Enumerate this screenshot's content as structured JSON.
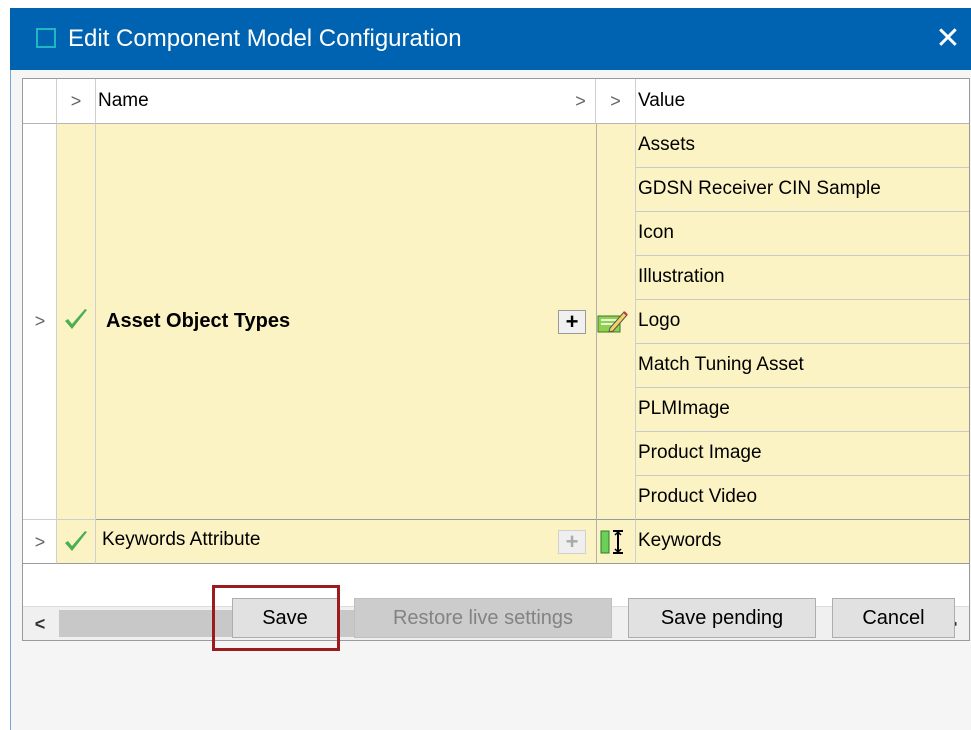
{
  "window": {
    "title": "Edit Component Model Configuration",
    "close_glyph": "✕"
  },
  "grid": {
    "header": {
      "expand_glyph": ">",
      "name": "Name",
      "name_chevron": ">",
      "value_chevron": ">",
      "value": "Value"
    },
    "rows": [
      {
        "expander": ">",
        "status_icon": "checkmark-icon",
        "name": "Asset Object Types",
        "bold": true,
        "add_glyph": "+",
        "add_enabled": true,
        "editor_icon": "edit-list-icon",
        "values": [
          "Assets",
          "GDSN Receiver CIN Sample",
          "Icon",
          "Illustration",
          "Logo",
          "Match Tuning Asset",
          "PLMImage",
          "Product Image",
          "Product Video"
        ]
      },
      {
        "expander": ">",
        "status_icon": "checkmark-icon",
        "name": "Keywords Attribute",
        "bold": false,
        "add_glyph": "+",
        "add_enabled": false,
        "editor_icon": "text-attribute-icon",
        "values": [
          "Keywords"
        ]
      }
    ]
  },
  "scrollbar": {
    "left_glyph": "<",
    "right_glyph": ">"
  },
  "buttons": {
    "save": "Save",
    "restore": "Restore live settings",
    "save_pending": "Save pending",
    "cancel": "Cancel"
  },
  "colors": {
    "titlebar": "#0063b1",
    "row_highlight": "#fbf3c4",
    "focus_frame": "#9b1b1e"
  }
}
